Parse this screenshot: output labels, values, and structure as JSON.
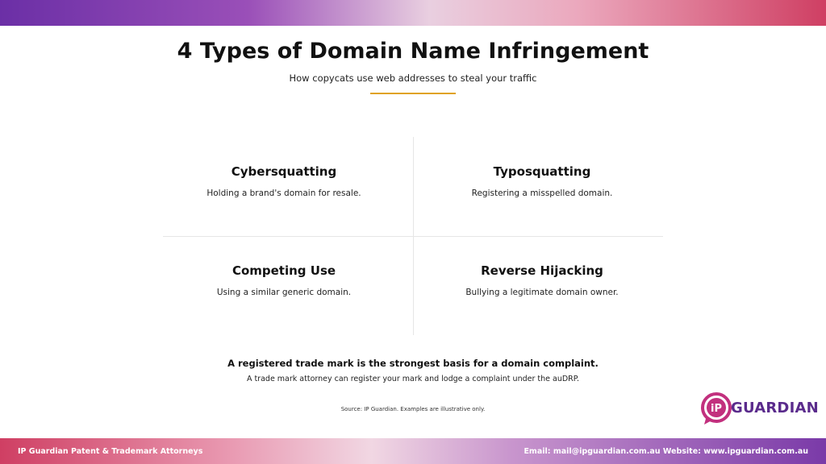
{
  "header": {
    "title": "4 Types of Domain Name Infringement",
    "subtitle": "How copycats use web addresses to steal your traffic"
  },
  "grid": {
    "items": [
      {
        "title": "Cybersquatting",
        "description": "Holding a brand's domain for resale."
      },
      {
        "title": "Typosquatting",
        "description": "Registering a misspelled domain."
      },
      {
        "title": "Competing Use",
        "description": "Using a similar generic domain."
      },
      {
        "title": "Reverse Hijacking",
        "description": "Bullying a legitimate domain owner."
      }
    ]
  },
  "callout": {
    "title": "A registered trade mark is the strongest basis for a domain complaint.",
    "text": "A trade mark attorney can register your mark and lodge a complaint under the auDRP."
  },
  "source": "Source: IP Guardian. Examples are illustrative only.",
  "logo": {
    "mark_text": "iP",
    "word": "GUARDIAN",
    "colors": {
      "mark": "#c2307e",
      "word": "#5a2b8c"
    }
  },
  "footer": {
    "left": "IP Guardian Patent & Trademark Attorneys",
    "right": "Email: mail@ipguardian.com.au Website: www.ipguardian.com.au"
  },
  "colors": {
    "accent_rule": "#e0a21d",
    "band_purple": "#6b2fa6",
    "band_pink": "#cf3f63"
  }
}
